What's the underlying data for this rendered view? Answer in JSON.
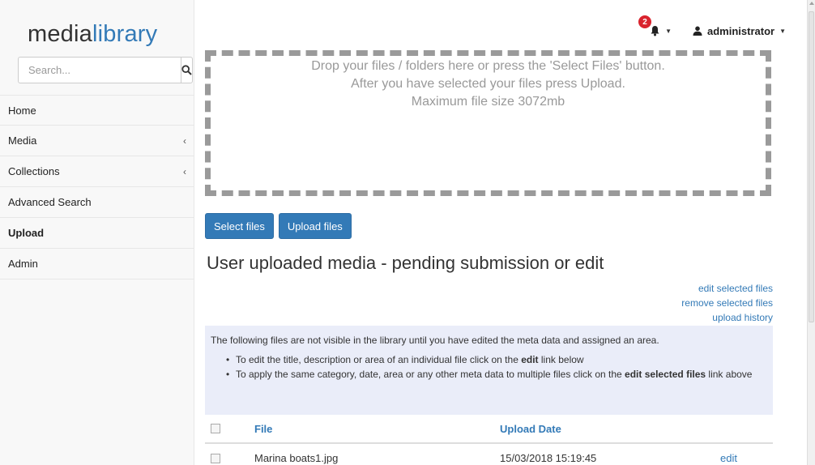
{
  "brand": {
    "part1": "media",
    "part2": "library"
  },
  "search": {
    "placeholder": "Search..."
  },
  "nav": [
    {
      "label": "Home",
      "chevron": false
    },
    {
      "label": "Media",
      "chevron": true
    },
    {
      "label": "Collections",
      "chevron": true
    },
    {
      "label": "Advanced Search",
      "chevron": false
    },
    {
      "label": "Upload",
      "chevron": false,
      "active": true
    },
    {
      "label": "Admin",
      "chevron": false
    }
  ],
  "topbar": {
    "notification_count": "2",
    "username": "administrator"
  },
  "dropzone": {
    "line1": "Drop your files / folders here or press the 'Select Files' button.",
    "line2": "After you have selected your files press Upload.",
    "line3": "Maximum file size 3072mb"
  },
  "buttons": {
    "select": "Select files",
    "upload": "Upload files"
  },
  "section_title": "User uploaded media - pending submission or edit",
  "links": {
    "edit_selected": "edit selected files",
    "remove_selected": "remove selected files",
    "upload_history": "upload history"
  },
  "info": {
    "intro": "The following files are not visible in the library until you have edited the meta data and assigned an area.",
    "bullet1_pre": "To edit the title, description or area of an individual file click on the ",
    "bullet1_bold": "edit",
    "bullet1_post": " link below",
    "bullet2_pre": "To apply the same category, date, area or any other meta data to multiple files click on the ",
    "bullet2_bold": "edit selected files",
    "bullet2_post": " link above"
  },
  "table": {
    "headers": {
      "file": "File",
      "upload_date": "Upload Date"
    },
    "rows": [
      {
        "file": "Marina boats1.jpg",
        "upload_date": "15/03/2018 15:19:45",
        "action": "edit"
      }
    ]
  },
  "colors": {
    "accent": "#337ab7",
    "badge": "#d9232d",
    "info_bg": "#eaedf9"
  }
}
